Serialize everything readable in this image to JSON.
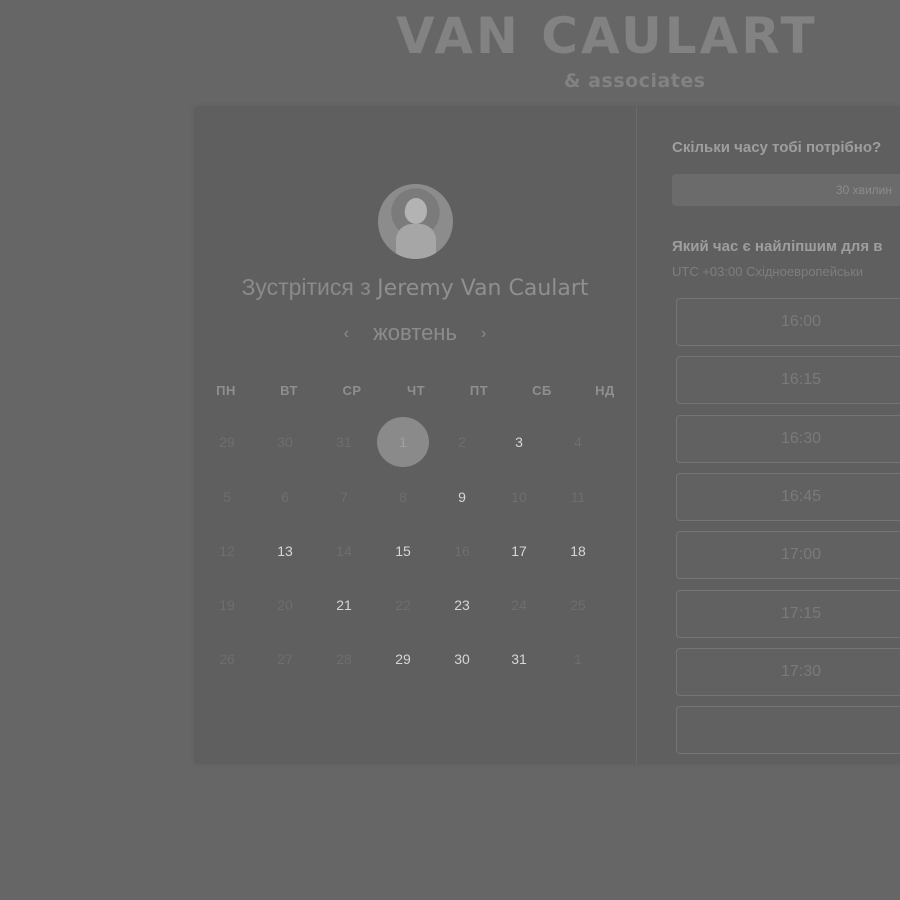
{
  "brand": {
    "name": "VAN CAULART",
    "subtitle": "& associates"
  },
  "calendar": {
    "meet_prefix": "Зустрітися з",
    "host_name": "Jeremy Van Caulart",
    "month": "жовтень",
    "prev_icon": "chevron-left-icon",
    "next_icon": "chevron-right-icon",
    "weekdays": [
      "ПН",
      "ВТ",
      "СР",
      "ЧТ",
      "ПТ",
      "СБ",
      "НД"
    ],
    "weeks": [
      [
        {
          "d": "29",
          "s": "muted"
        },
        {
          "d": "30",
          "s": "muted"
        },
        {
          "d": "31",
          "s": "muted"
        },
        {
          "d": "1",
          "s": "selected"
        },
        {
          "d": "2",
          "s": "muted"
        },
        {
          "d": "3",
          "s": "available"
        },
        {
          "d": "4",
          "s": "muted"
        }
      ],
      [
        {
          "d": "5",
          "s": "muted"
        },
        {
          "d": "6",
          "s": "muted"
        },
        {
          "d": "7",
          "s": "muted"
        },
        {
          "d": "8",
          "s": "muted"
        },
        {
          "d": "9",
          "s": "available"
        },
        {
          "d": "10",
          "s": "muted"
        },
        {
          "d": "11",
          "s": "muted"
        }
      ],
      [
        {
          "d": "12",
          "s": "muted"
        },
        {
          "d": "13",
          "s": "available"
        },
        {
          "d": "14",
          "s": "muted"
        },
        {
          "d": "15",
          "s": "available"
        },
        {
          "d": "16",
          "s": "muted"
        },
        {
          "d": "17",
          "s": "available"
        },
        {
          "d": "18",
          "s": "available"
        }
      ],
      [
        {
          "d": "19",
          "s": "muted"
        },
        {
          "d": "20",
          "s": "muted"
        },
        {
          "d": "21",
          "s": "available"
        },
        {
          "d": "22",
          "s": "muted"
        },
        {
          "d": "23",
          "s": "available"
        },
        {
          "d": "24",
          "s": "muted"
        },
        {
          "d": "25",
          "s": "muted"
        }
      ],
      [
        {
          "d": "26",
          "s": "muted"
        },
        {
          "d": "27",
          "s": "muted"
        },
        {
          "d": "28",
          "s": "muted"
        },
        {
          "d": "29",
          "s": "available"
        },
        {
          "d": "30",
          "s": "available"
        },
        {
          "d": "31",
          "s": "available"
        },
        {
          "d": "1",
          "s": "muted"
        }
      ]
    ]
  },
  "booking": {
    "duration_question": "Скільки часу тобі потрібно?",
    "duration_value": "30 хвилин",
    "time_question": "Який час є найліпшим для в",
    "timezone": "UTC +03:00 Східноевропейськи",
    "slots": [
      "16:00",
      "16:15",
      "16:30",
      "16:45",
      "17:00",
      "17:15",
      "17:30"
    ]
  }
}
